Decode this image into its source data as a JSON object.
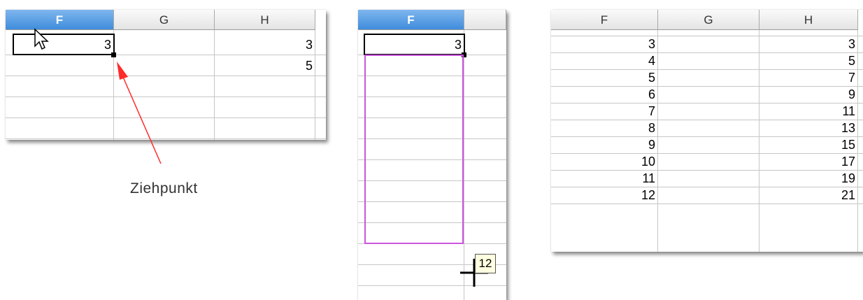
{
  "panel1": {
    "columns": [
      "F",
      "G",
      "H"
    ],
    "f1": "3",
    "h1": "3",
    "h2": "5",
    "caption": "Ziehpunkt"
  },
  "panel2": {
    "column": "F",
    "f1": "3",
    "tooltip": "12"
  },
  "panel3": {
    "columns": [
      "F",
      "G",
      "H"
    ],
    "rows": [
      {
        "f": "3",
        "g": "",
        "h": "3"
      },
      {
        "f": "4",
        "g": "",
        "h": "5"
      },
      {
        "f": "5",
        "g": "",
        "h": "7"
      },
      {
        "f": "6",
        "g": "",
        "h": "9"
      },
      {
        "f": "7",
        "g": "",
        "h": "11"
      },
      {
        "f": "8",
        "g": "",
        "h": "13"
      },
      {
        "f": "9",
        "g": "",
        "h": "15"
      },
      {
        "f": "10",
        "g": "",
        "h": "17"
      },
      {
        "f": "11",
        "g": "",
        "h": "19"
      },
      {
        "f": "12",
        "g": "",
        "h": "21"
      }
    ]
  },
  "colors": {
    "selected_header": "#4a90e2",
    "autofill_border": "#cc55dd",
    "arrow": "#ff2a2a"
  },
  "icons": [
    "mouse-pointer-icon",
    "crosshair-cursor-icon"
  ]
}
